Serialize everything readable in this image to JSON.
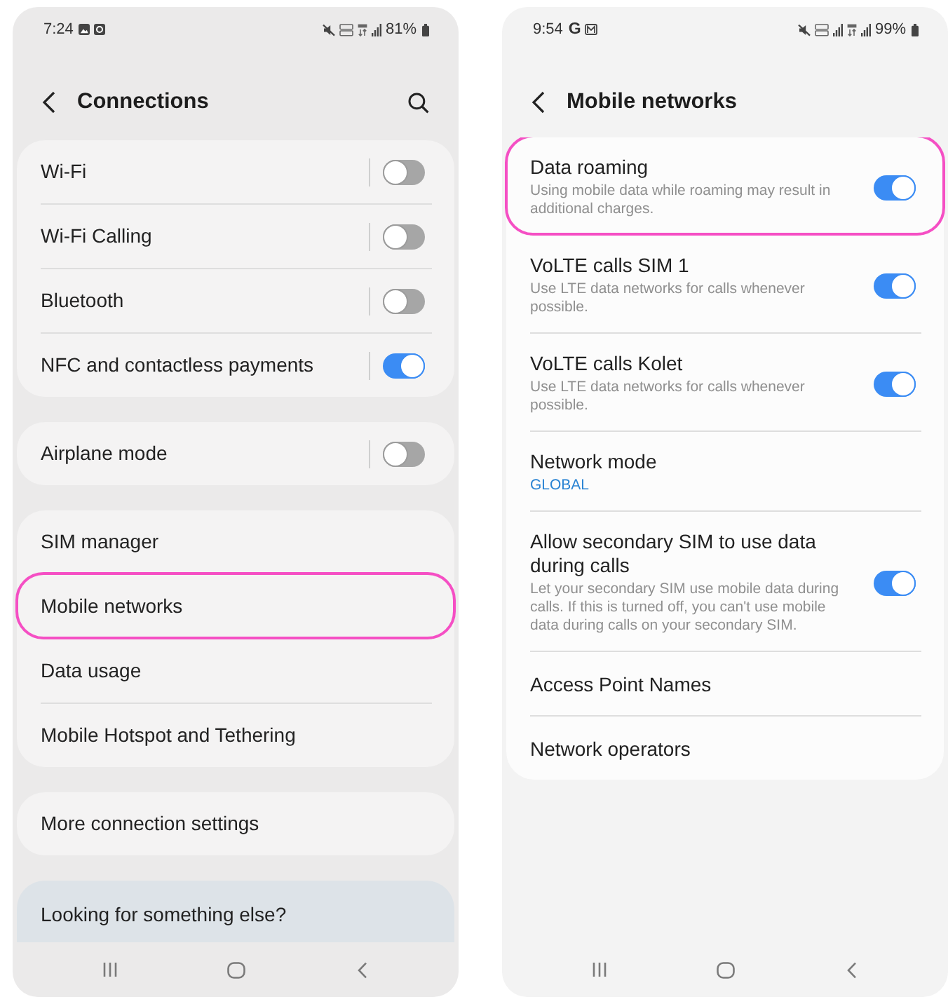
{
  "screens": [
    {
      "status_bar": {
        "time": "7:24",
        "battery": "81%"
      },
      "header": {
        "title": "Connections",
        "search": true
      },
      "groups": [
        {
          "kind": "card",
          "items": [
            {
              "label": "Wi-Fi",
              "kind": "split",
              "on": false,
              "highlighted": false
            },
            {
              "label": "Wi-Fi Calling",
              "kind": "split",
              "on": false,
              "highlighted": false
            },
            {
              "label": "Bluetooth",
              "kind": "split",
              "on": false,
              "highlighted": false
            },
            {
              "label": "NFC and contactless payments",
              "kind": "split",
              "on": true,
              "highlighted": false
            }
          ]
        },
        {
          "kind": "card",
          "items": [
            {
              "label": "Airplane mode",
              "kind": "split",
              "on": false,
              "highlighted": false
            }
          ]
        },
        {
          "kind": "card",
          "items": [
            {
              "label": "SIM manager",
              "kind": "link",
              "highlighted": false
            },
            {
              "label": "Mobile networks",
              "kind": "link",
              "highlighted": true
            },
            {
              "label": "Data usage",
              "kind": "link",
              "highlighted": false
            },
            {
              "label": "Mobile Hotspot and Tethering",
              "kind": "link",
              "highlighted": false
            }
          ]
        },
        {
          "kind": "card",
          "items": [
            {
              "label": "More connection settings",
              "kind": "link",
              "highlighted": false
            }
          ]
        },
        {
          "kind": "suggestion",
          "items": [
            {
              "label": "Looking for something else?",
              "kind": "link",
              "highlighted": false
            }
          ]
        }
      ]
    },
    {
      "status_bar": {
        "time": "9:54",
        "app_glyph": "G",
        "battery": "99%"
      },
      "header": {
        "title": "Mobile networks"
      },
      "groups": [
        {
          "kind": "card",
          "items": [
            {
              "label": "Data roaming",
              "kind": "switch",
              "description": "Using mobile data while roaming may result in additional charges.",
              "on": true,
              "highlighted": true
            },
            {
              "label": "VoLTE calls SIM 1",
              "kind": "switch",
              "description": "Use LTE data networks for calls whenever possible.",
              "on": true,
              "highlighted": false
            },
            {
              "label": "VoLTE calls Kolet",
              "kind": "switch",
              "description": "Use LTE data networks for calls whenever possible.",
              "on": true,
              "highlighted": false
            },
            {
              "label": "Network mode",
              "kind": "value",
              "value": "GLOBAL",
              "highlighted": false
            },
            {
              "label": "Allow secondary SIM to use data during calls",
              "kind": "switch",
              "description": "Let your secondary SIM use mobile data during calls. If this is turned off, you can't use mobile data during calls on your secondary SIM.",
              "on": true,
              "highlighted": false
            },
            {
              "label": "Access Point Names",
              "kind": "link",
              "highlighted": false
            },
            {
              "label": "Network operators",
              "kind": "link",
              "highlighted": false
            }
          ]
        }
      ]
    }
  ]
}
